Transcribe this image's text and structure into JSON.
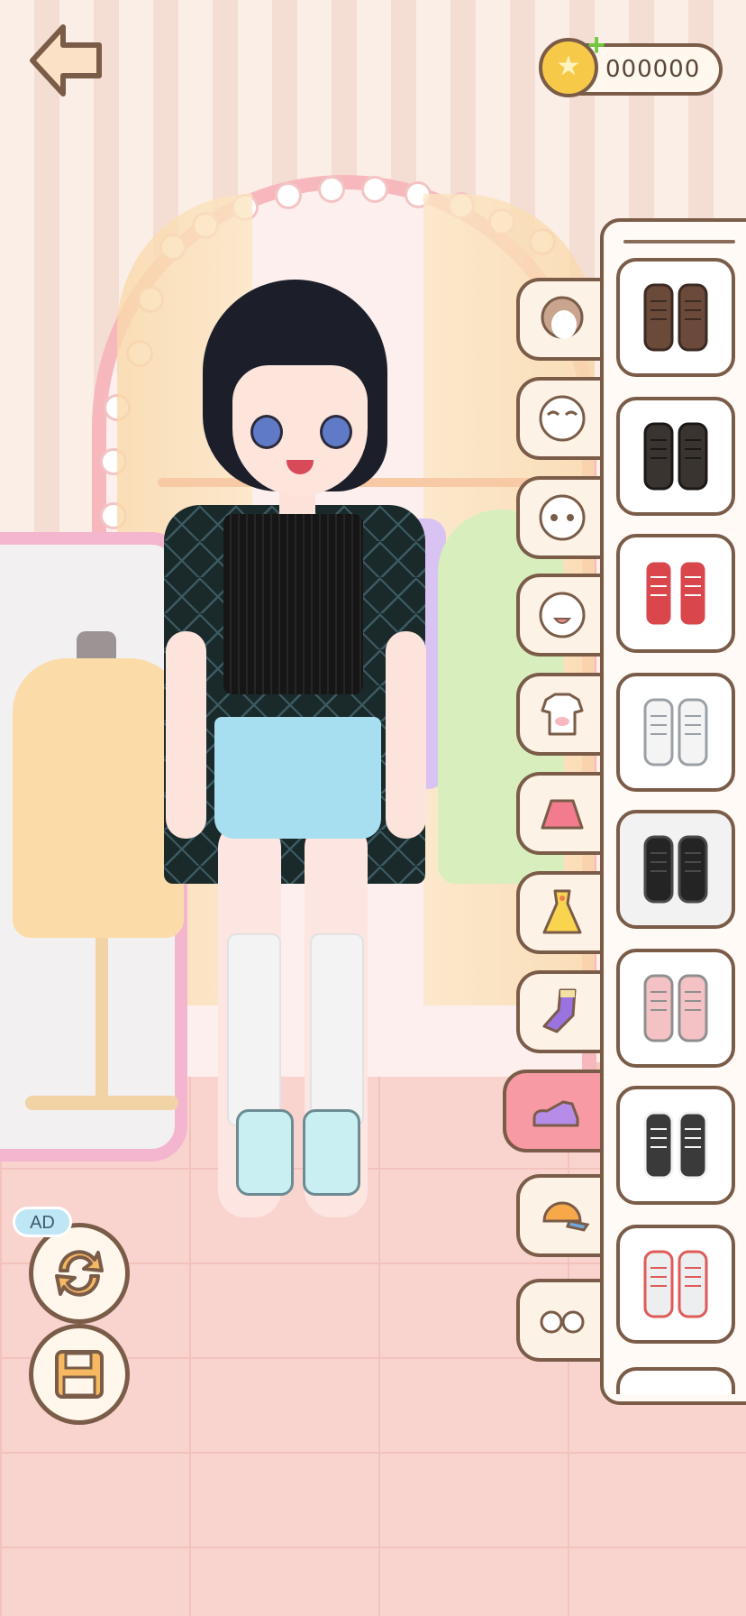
{
  "hud": {
    "coins": "000000",
    "ad_label": "AD"
  },
  "categories": [
    {
      "name": "hair",
      "icon": "hair-icon",
      "active": false
    },
    {
      "name": "eyebrows",
      "icon": "eyebrows-icon",
      "active": false
    },
    {
      "name": "eyes",
      "icon": "eyes-icon",
      "active": false
    },
    {
      "name": "mouth",
      "icon": "mouth-icon",
      "active": false
    },
    {
      "name": "tops",
      "icon": "tshirt-icon",
      "active": false
    },
    {
      "name": "skirts",
      "icon": "skirt-icon",
      "active": false
    },
    {
      "name": "dresses",
      "icon": "dress-icon",
      "active": false
    },
    {
      "name": "socks",
      "icon": "sock-icon",
      "active": false
    },
    {
      "name": "shoes",
      "icon": "shoe-icon",
      "active": true
    },
    {
      "name": "hats",
      "icon": "cap-icon",
      "active": false
    },
    {
      "name": "glasses",
      "icon": "glasses-icon",
      "active": false
    }
  ],
  "items": [
    {
      "name": "brown-boots",
      "color": "#6b4a3a",
      "accent": "#3b2a22",
      "selected": false
    },
    {
      "name": "black-boots",
      "color": "#3a3431",
      "accent": "#1c1816",
      "selected": false
    },
    {
      "name": "red-sneakers",
      "color": "#d9474c",
      "accent": "#ffffff",
      "selected": false
    },
    {
      "name": "white-sneakers",
      "color": "#f4f4f4",
      "accent": "#9aa0a6",
      "selected": false
    },
    {
      "name": "black-loafers",
      "color": "#242424",
      "accent": "#4a4a4a",
      "selected": true
    },
    {
      "name": "pink-sneakers",
      "color": "#f4c2c5",
      "accent": "#8f8f8f",
      "selected": false
    },
    {
      "name": "black-white-sneakers",
      "color": "#3a3a3a",
      "accent": "#f2f2f2",
      "selected": false
    },
    {
      "name": "flower-clogs",
      "color": "#eceeef",
      "accent": "#e05a5a",
      "selected": false
    }
  ],
  "colors": {
    "outline": "#7a5c48",
    "tab_bg": "#fdf2e6",
    "tab_active": "#f79aa4",
    "coin": "#f7c948",
    "plus": "#6fc93e"
  }
}
